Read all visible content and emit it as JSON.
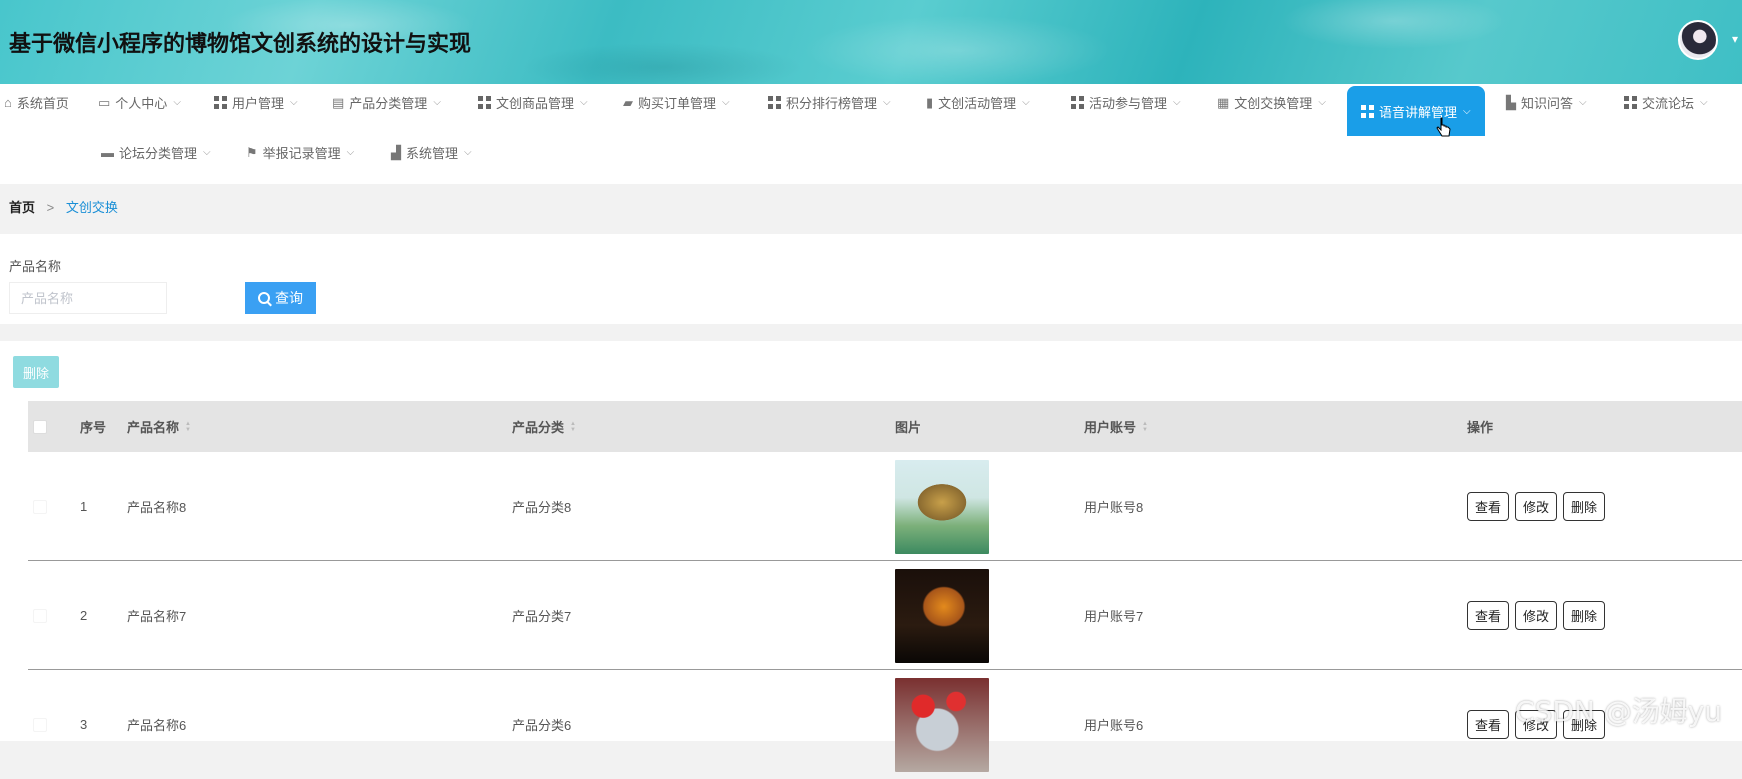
{
  "app": {
    "title": "基于微信小程序的博物馆文创系统的设计与实现"
  },
  "nav": {
    "items": [
      {
        "label": "系统首页",
        "icon": "home-icon"
      },
      {
        "label": "个人中心",
        "icon": "card-icon"
      },
      {
        "label": "用户管理",
        "icon": "grid-icon"
      },
      {
        "label": "产品分类管理",
        "icon": "chat-icon"
      },
      {
        "label": "文创商品管理",
        "icon": "grid-icon"
      },
      {
        "label": "购买订单管理",
        "icon": "briefcase-icon"
      },
      {
        "label": "积分排行榜管理",
        "icon": "grid-icon"
      },
      {
        "label": "文创活动管理",
        "icon": "clipboard-icon"
      },
      {
        "label": "活动参与管理",
        "icon": "grid-icon"
      },
      {
        "label": "文创交换管理",
        "icon": "table-icon"
      },
      {
        "label": "语音讲解管理",
        "icon": "grid-icon"
      },
      {
        "label": "知识问答",
        "icon": "chart-icon"
      },
      {
        "label": "交流论坛",
        "icon": "grid-icon"
      },
      {
        "label": "论坛分类管理",
        "icon": "monitor-icon"
      },
      {
        "label": "举报记录管理",
        "icon": "flag-icon"
      },
      {
        "label": "系统管理",
        "icon": "settings-icon"
      }
    ],
    "active": "语音讲解管理",
    "active_color": "#1a9ee8"
  },
  "breadcrumb": {
    "home": "首页",
    "separator": ">",
    "current": "文创交换"
  },
  "search": {
    "label": "产品名称",
    "placeholder": "产品名称",
    "value": "",
    "button_label": "查询",
    "button_color": "#3aa0f3"
  },
  "toolbar": {
    "delete_label": "删除"
  },
  "table": {
    "columns": {
      "index": "序号",
      "name": "产品名称",
      "category": "产品分类",
      "image": "图片",
      "account": "用户账号",
      "actions": "操作"
    },
    "rows": [
      {
        "index": "1",
        "name": "产品名称8",
        "category": "产品分类8",
        "image": "golden-dragon-sculpture",
        "account": "用户账号8"
      },
      {
        "index": "2",
        "name": "产品名称7",
        "category": "产品分类7",
        "image": "golden-bonsai-tree",
        "account": "用户账号7"
      },
      {
        "index": "3",
        "name": "产品名称6",
        "category": "产品分类6",
        "image": "red-flower-vase",
        "account": "用户账号6"
      }
    ],
    "actions": {
      "view": "查看",
      "edit": "修改",
      "delete": "删除"
    }
  },
  "watermark": "CSDN @汤姆yu"
}
